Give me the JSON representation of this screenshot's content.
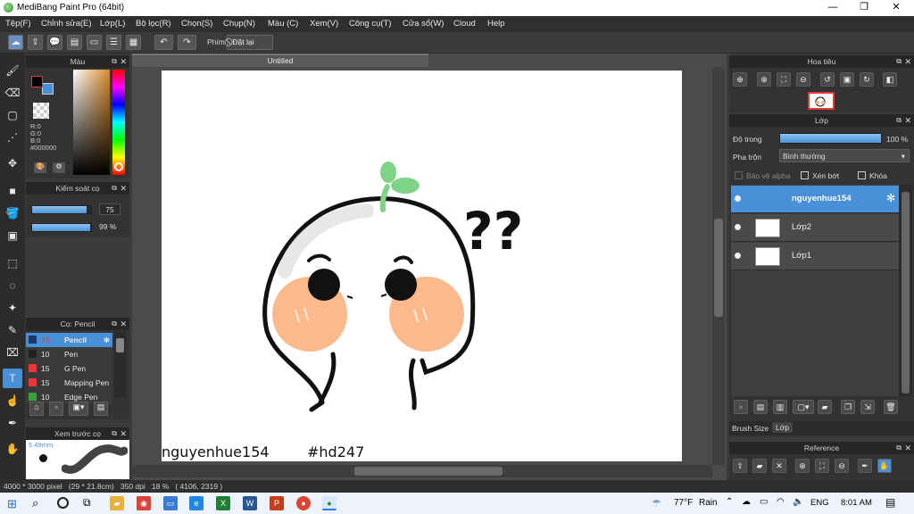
{
  "app": {
    "title": "MediBang Paint Pro (64bit)"
  },
  "window_controls": {
    "minimize": "—",
    "restore": "❐",
    "close": "✕"
  },
  "menu": [
    "Tệp(F)",
    "Chỉnh sửa(E)",
    "Lớp(L)",
    "Bộ lọc(R)",
    "Chọn(S)",
    "Chụp(N)",
    "Màu (C)",
    "Xem(V)",
    "Công cụ(T)",
    "Cửa sổ(W)",
    "Cloud",
    "Help"
  ],
  "toolbar": {
    "shortcut_label": "Phím",
    "reset_label": "Đặt lại"
  },
  "color_panel": {
    "title": "Màu",
    "r": "R:0",
    "g": "G:0",
    "b": "B:0",
    "hex": "#000000",
    "primary": "#000000",
    "secondary": "#4a90d9"
  },
  "brush_control": {
    "title": "Kiểm soát cọ",
    "size": "75",
    "opacity": "99 %",
    "size_pct": 0.92,
    "opacity_pct": 0.99
  },
  "brush_panel": {
    "title": "Cọ: Pencil",
    "items": [
      {
        "size": "75",
        "name": "Pencil",
        "color": "#1b3a6a",
        "selected": true
      },
      {
        "size": "10",
        "name": "Pen",
        "color": "#222222",
        "selected": false
      },
      {
        "size": "15",
        "name": "G Pen",
        "color": "#e53935",
        "selected": false
      },
      {
        "size": "15",
        "name": "Mapping Pen",
        "color": "#e53935",
        "selected": false
      },
      {
        "size": "10",
        "name": "Edge Pen",
        "color": "#3aa13a",
        "selected": false
      }
    ]
  },
  "brush_preview": {
    "title": "Xem trước cọ",
    "size_text": "5.49mm"
  },
  "canvas": {
    "tab_title": "Untitled",
    "text_left": "nguyenhue154",
    "text_right": "#hd247",
    "question_marks": "??"
  },
  "navigator": {
    "title": "Hoa tiêu"
  },
  "layers_panel": {
    "title": "Lớp",
    "opacity_label": "Độ trong",
    "opacity_value": "100 %",
    "blend_label": "Pha trộn",
    "blend_value": "Bình thường",
    "protect_alpha": "Bảo vệ alpha",
    "clipping": "Xén bớt",
    "lock": "Khóa",
    "layers": [
      {
        "name": "nguyenhue154",
        "selected": true
      },
      {
        "name": "Lớp2",
        "selected": false
      },
      {
        "name": "Lớp1",
        "selected": false
      }
    ],
    "tabs": [
      "Brush Size",
      "Lớp"
    ]
  },
  "reference_panel": {
    "title": "Reference"
  },
  "status": {
    "text": "4000 * 3000 pixel   (29 * 21.8cm)   350 dpi   18 %   ( 4106, 2319 )"
  },
  "taskbar": {
    "weather_temp": "77°F",
    "weather_desc": "Rain",
    "lang": "ENG",
    "time": "8:01 AM"
  }
}
